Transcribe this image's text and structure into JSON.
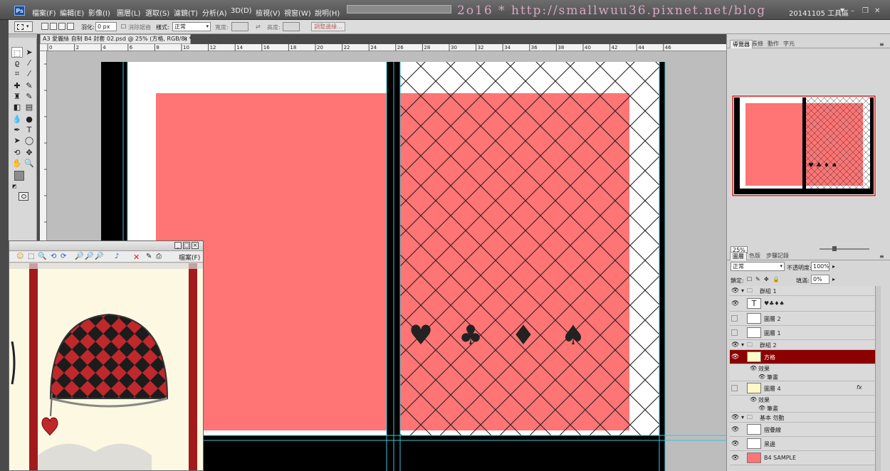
{
  "app": {
    "logo": "Ps",
    "workspace": "20141105 工具區",
    "watermark": "2o16 * http://smallwuu36.pixnet.net/blog"
  },
  "menu": [
    "檔案(F)",
    "編輯(E)",
    "影像(I)",
    "圖層(L)",
    "選取(S)",
    "濾鏡(T)",
    "分析(A)",
    "3D(D)",
    "檢視(V)",
    "視窗(W)",
    "說明(H)"
  ],
  "options": {
    "feather_label": "羽化:",
    "feather_value": "0 px",
    "antialias_label": "消除鋸齒",
    "style_label": "樣式:",
    "style_value": "正常",
    "width_label": "寬度:",
    "height_label": "高度:",
    "refine_edge_button": "調整邊緣..."
  },
  "document": {
    "tab_title": "A3 愛麗絲 自制 B4 封套 02.psd @ 25% (方格, RGB/8) *",
    "ruler_labels": [
      "0",
      "2",
      "4",
      "6",
      "8",
      "10",
      "12",
      "14",
      "16",
      "18",
      "20",
      "22",
      "24",
      "26",
      "28",
      "30",
      "32",
      "34",
      "36",
      "38",
      "40",
      "42",
      "44",
      "46"
    ],
    "suits": [
      "♥",
      "♣",
      "♦",
      "♠"
    ]
  },
  "navigator": {
    "tabs": [
      "導覽器",
      "長條",
      "動作",
      "字元"
    ],
    "zoom": "25%"
  },
  "layers_panel": {
    "tabs": [
      "圖層",
      "色版",
      "步驟記錄"
    ],
    "blend_mode": "正常",
    "opacity_label": "不透明度:",
    "opacity_value": "100%",
    "lock_label": "鎖定:",
    "fill_label": "填滿:",
    "fill_value": "0%",
    "layers": [
      {
        "name": "群組 1",
        "kind": "group",
        "visible": true
      },
      {
        "name": "♥♣♦♠",
        "kind": "text",
        "visible": true
      },
      {
        "name": "圖層 2",
        "kind": "layer",
        "visible": false
      },
      {
        "name": "圖層 1",
        "kind": "layer",
        "visible": false
      },
      {
        "name": "群組 2",
        "kind": "group",
        "visible": true
      },
      {
        "name": "方格",
        "kind": "layer",
        "visible": true,
        "selected": true
      },
      {
        "name": "效果",
        "kind": "effect",
        "visible": true
      },
      {
        "name": "筆畫",
        "kind": "effect",
        "visible": true
      },
      {
        "name": "圖層 4",
        "kind": "layer",
        "visible": false,
        "fx": "fx"
      },
      {
        "name": "效果",
        "kind": "effect",
        "visible": true
      },
      {
        "name": "筆畫",
        "kind": "effect",
        "visible": true
      },
      {
        "name": "基本 勿動",
        "kind": "group",
        "visible": true
      },
      {
        "name": "摺疊線",
        "kind": "layer",
        "visible": true
      },
      {
        "name": "黑邊",
        "kind": "layer",
        "visible": true
      },
      {
        "name": "B4 SAMPLE",
        "kind": "layer",
        "visible": true
      }
    ]
  },
  "viewer": {
    "menu_label": "檔案(F)"
  },
  "colors": {
    "salmon": "#ff7474",
    "selected_layer": "#8b0000",
    "lattice_line": "#222222",
    "bag_red": "#c0282c"
  }
}
